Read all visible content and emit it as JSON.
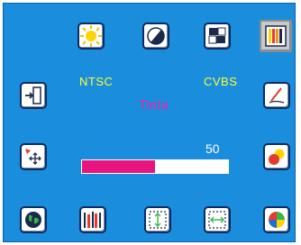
{
  "osd": {
    "standard": "NTSC",
    "input": "CVBS",
    "title": "Tinta",
    "value": "50",
    "level_fraction": 0.5
  },
  "colors": {
    "background": "#1a8ddc",
    "label": "#ffff33",
    "title": "#ff1aa8",
    "bar_fill": "#e8157e",
    "bar_empty": "#ffffff"
  },
  "icons": {
    "top": [
      "brightness-icon",
      "contrast-icon",
      "color-adjust-icon",
      "color-bars-icon"
    ],
    "left": [
      "exit-icon",
      "position-icon"
    ],
    "right": [
      "pen-edit-icon",
      "color-circles-icon"
    ],
    "bottom": [
      "globe-icon",
      "tools-icon",
      "vertical-size-icon",
      "horizontal-size-icon",
      "color-wheel-icon"
    ]
  }
}
